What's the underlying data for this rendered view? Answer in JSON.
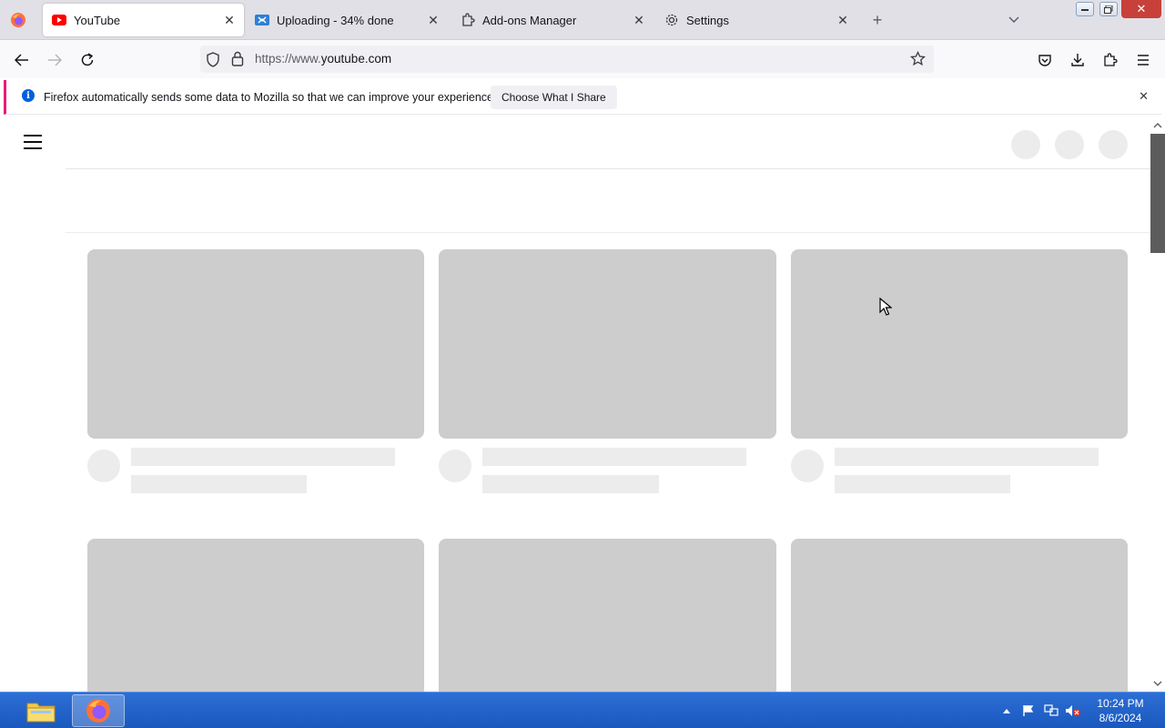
{
  "tabs": [
    {
      "label": "YouTube",
      "active": true,
      "icon": "youtube-icon"
    },
    {
      "label": "Uploading - 34% done",
      "active": false,
      "icon": "upload-icon"
    },
    {
      "label": "Add-ons Manager",
      "active": false,
      "icon": "puzzle-icon"
    },
    {
      "label": "Settings",
      "active": false,
      "icon": "gear-icon"
    }
  ],
  "toolbar": {
    "url_prefix": "https://www.",
    "url_domain": "youtube.com"
  },
  "notification": {
    "text": "Firefox automatically sends some data to Mozilla so that we can improve your experience.",
    "button_label": "Choose What I Share"
  },
  "taskbar": {
    "time": "10:24 PM",
    "date": "8/6/2024"
  },
  "colors": {
    "youtube_red": "#ff0000",
    "skeleton": "#cdcdcd",
    "notification_accent": "#e21c80",
    "taskbar": "#1a58bd"
  }
}
